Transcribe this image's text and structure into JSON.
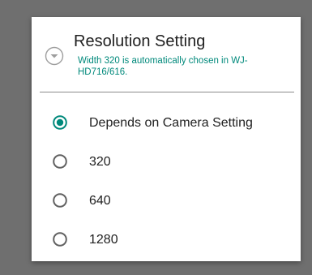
{
  "dialog": {
    "title": "Resolution Setting",
    "subtitle": "Width 320 is automatically chosen in WJ-HD716/616.",
    "header_icon": "chevron-down-circle-icon",
    "accent_color": "#00897b",
    "selected_index": 0,
    "options": [
      {
        "label": "Depends on Camera Setting",
        "selected": true
      },
      {
        "label": "320",
        "selected": false
      },
      {
        "label": "640",
        "selected": false
      },
      {
        "label": "1280",
        "selected": false
      }
    ]
  }
}
